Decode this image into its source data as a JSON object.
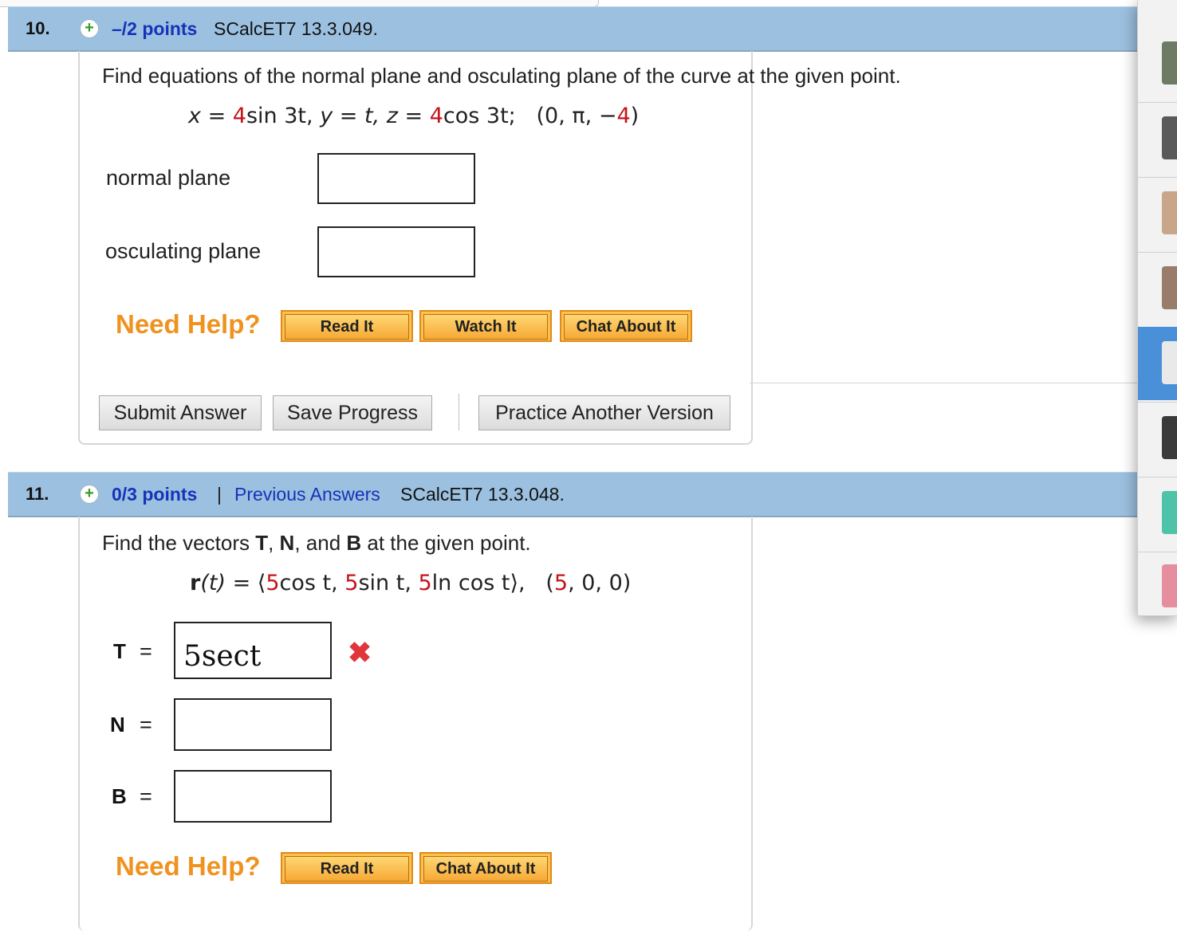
{
  "questions": [
    {
      "number": "10.",
      "points": "–/2 points",
      "code": "SCalcET7 13.3.049.",
      "prompt": "Find equations of the normal plane and osculating plane of the curve at the given point.",
      "formula": {
        "x_lhs": "x",
        "x_coef": "4",
        "x_rest": "sin 3t,",
        "y_part": "y = t,",
        "z_lhs": "z",
        "z_coef": "4",
        "z_rest": "cos 3t;",
        "point_open": "(0, π, −",
        "point_red": "4",
        "point_close": ")"
      },
      "fields": [
        {
          "label": "normal plane",
          "value": ""
        },
        {
          "label": "osculating plane",
          "value": ""
        }
      ],
      "need_help": "Need Help?",
      "help_buttons": [
        "Read It",
        "Watch It",
        "Chat About It"
      ],
      "actions": [
        "Submit Answer",
        "Save Progress",
        "Practice Another Version"
      ]
    },
    {
      "number": "11.",
      "points": "0/3 points",
      "separator": "|",
      "previous": "Previous Answers",
      "code": "SCalcET7 13.3.048.",
      "prompt_pre": "Find the vectors ",
      "prompt_T": "T",
      "prompt_c1": ", ",
      "prompt_N": "N",
      "prompt_c2": ", and ",
      "prompt_B": "B",
      "prompt_post": " at the given point.",
      "formula": {
        "r": "r",
        "t_arg": "(t) = ",
        "open": "⟨",
        "c1": "5",
        "t1": "cos t, ",
        "c2": "5",
        "t2": "sin t, ",
        "c3": "5",
        "t3": "ln cos t",
        "close": "⟩",
        "comma": ",",
        "p_open": "(",
        "p_red": "5",
        "p_rest": ", 0, 0)"
      },
      "fields": [
        {
          "label": "T",
          "eq": "=",
          "value": "5sect",
          "status": "incorrect"
        },
        {
          "label": "N",
          "eq": "=",
          "value": ""
        },
        {
          "label": "B",
          "eq": "=",
          "value": ""
        }
      ],
      "incorrect_mark": "✖",
      "need_help": "Need Help?",
      "help_buttons": [
        "Read It",
        "Chat About It"
      ]
    }
  ],
  "colors": {
    "header_bg": "#9cc0df",
    "link_blue": "#1533b8",
    "need_help_orange": "#f0921f",
    "help_button": "#fbc24d",
    "error_red": "#e0353a",
    "side_selected": "#4a90d9"
  },
  "side_panel": {
    "icons": [
      "photo-thumb",
      "photo-thumb",
      "avatar-icon",
      "avatar-icon",
      "avatar-icon",
      "avatar-icon",
      "avatar-icon",
      "avatar-icon"
    ]
  }
}
